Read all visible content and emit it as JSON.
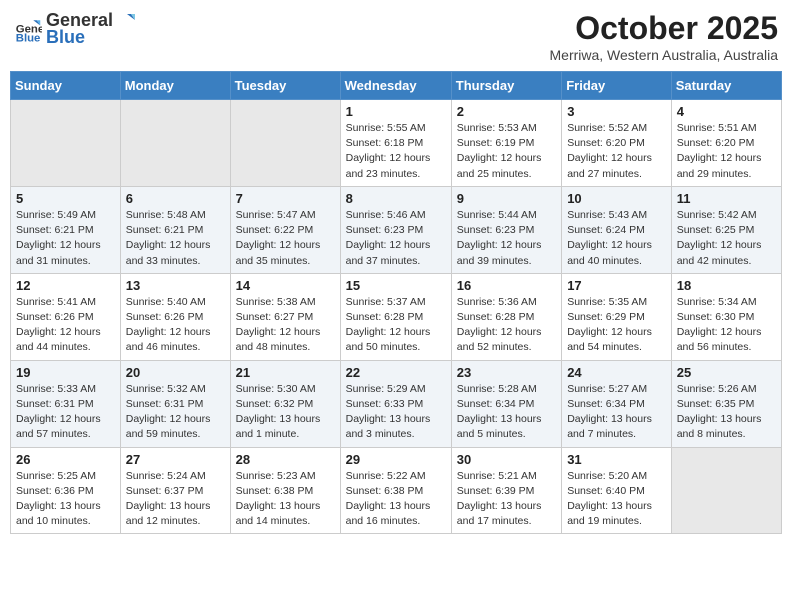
{
  "header": {
    "logo_general": "General",
    "logo_blue": "Blue",
    "month": "October 2025",
    "location": "Merriwa, Western Australia, Australia"
  },
  "weekdays": [
    "Sunday",
    "Monday",
    "Tuesday",
    "Wednesday",
    "Thursday",
    "Friday",
    "Saturday"
  ],
  "weeks": [
    [
      {
        "day": "",
        "info": ""
      },
      {
        "day": "",
        "info": ""
      },
      {
        "day": "",
        "info": ""
      },
      {
        "day": "1",
        "info": "Sunrise: 5:55 AM\nSunset: 6:18 PM\nDaylight: 12 hours and 23 minutes."
      },
      {
        "day": "2",
        "info": "Sunrise: 5:53 AM\nSunset: 6:19 PM\nDaylight: 12 hours and 25 minutes."
      },
      {
        "day": "3",
        "info": "Sunrise: 5:52 AM\nSunset: 6:20 PM\nDaylight: 12 hours and 27 minutes."
      },
      {
        "day": "4",
        "info": "Sunrise: 5:51 AM\nSunset: 6:20 PM\nDaylight: 12 hours and 29 minutes."
      }
    ],
    [
      {
        "day": "5",
        "info": "Sunrise: 5:49 AM\nSunset: 6:21 PM\nDaylight: 12 hours and 31 minutes."
      },
      {
        "day": "6",
        "info": "Sunrise: 5:48 AM\nSunset: 6:21 PM\nDaylight: 12 hours and 33 minutes."
      },
      {
        "day": "7",
        "info": "Sunrise: 5:47 AM\nSunset: 6:22 PM\nDaylight: 12 hours and 35 minutes."
      },
      {
        "day": "8",
        "info": "Sunrise: 5:46 AM\nSunset: 6:23 PM\nDaylight: 12 hours and 37 minutes."
      },
      {
        "day": "9",
        "info": "Sunrise: 5:44 AM\nSunset: 6:23 PM\nDaylight: 12 hours and 39 minutes."
      },
      {
        "day": "10",
        "info": "Sunrise: 5:43 AM\nSunset: 6:24 PM\nDaylight: 12 hours and 40 minutes."
      },
      {
        "day": "11",
        "info": "Sunrise: 5:42 AM\nSunset: 6:25 PM\nDaylight: 12 hours and 42 minutes."
      }
    ],
    [
      {
        "day": "12",
        "info": "Sunrise: 5:41 AM\nSunset: 6:26 PM\nDaylight: 12 hours and 44 minutes."
      },
      {
        "day": "13",
        "info": "Sunrise: 5:40 AM\nSunset: 6:26 PM\nDaylight: 12 hours and 46 minutes."
      },
      {
        "day": "14",
        "info": "Sunrise: 5:38 AM\nSunset: 6:27 PM\nDaylight: 12 hours and 48 minutes."
      },
      {
        "day": "15",
        "info": "Sunrise: 5:37 AM\nSunset: 6:28 PM\nDaylight: 12 hours and 50 minutes."
      },
      {
        "day": "16",
        "info": "Sunrise: 5:36 AM\nSunset: 6:28 PM\nDaylight: 12 hours and 52 minutes."
      },
      {
        "day": "17",
        "info": "Sunrise: 5:35 AM\nSunset: 6:29 PM\nDaylight: 12 hours and 54 minutes."
      },
      {
        "day": "18",
        "info": "Sunrise: 5:34 AM\nSunset: 6:30 PM\nDaylight: 12 hours and 56 minutes."
      }
    ],
    [
      {
        "day": "19",
        "info": "Sunrise: 5:33 AM\nSunset: 6:31 PM\nDaylight: 12 hours and 57 minutes."
      },
      {
        "day": "20",
        "info": "Sunrise: 5:32 AM\nSunset: 6:31 PM\nDaylight: 12 hours and 59 minutes."
      },
      {
        "day": "21",
        "info": "Sunrise: 5:30 AM\nSunset: 6:32 PM\nDaylight: 13 hours and 1 minute."
      },
      {
        "day": "22",
        "info": "Sunrise: 5:29 AM\nSunset: 6:33 PM\nDaylight: 13 hours and 3 minutes."
      },
      {
        "day": "23",
        "info": "Sunrise: 5:28 AM\nSunset: 6:34 PM\nDaylight: 13 hours and 5 minutes."
      },
      {
        "day": "24",
        "info": "Sunrise: 5:27 AM\nSunset: 6:34 PM\nDaylight: 13 hours and 7 minutes."
      },
      {
        "day": "25",
        "info": "Sunrise: 5:26 AM\nSunset: 6:35 PM\nDaylight: 13 hours and 8 minutes."
      }
    ],
    [
      {
        "day": "26",
        "info": "Sunrise: 5:25 AM\nSunset: 6:36 PM\nDaylight: 13 hours and 10 minutes."
      },
      {
        "day": "27",
        "info": "Sunrise: 5:24 AM\nSunset: 6:37 PM\nDaylight: 13 hours and 12 minutes."
      },
      {
        "day": "28",
        "info": "Sunrise: 5:23 AM\nSunset: 6:38 PM\nDaylight: 13 hours and 14 minutes."
      },
      {
        "day": "29",
        "info": "Sunrise: 5:22 AM\nSunset: 6:38 PM\nDaylight: 13 hours and 16 minutes."
      },
      {
        "day": "30",
        "info": "Sunrise: 5:21 AM\nSunset: 6:39 PM\nDaylight: 13 hours and 17 minutes."
      },
      {
        "day": "31",
        "info": "Sunrise: 5:20 AM\nSunset: 6:40 PM\nDaylight: 13 hours and 19 minutes."
      },
      {
        "day": "",
        "info": ""
      }
    ]
  ]
}
